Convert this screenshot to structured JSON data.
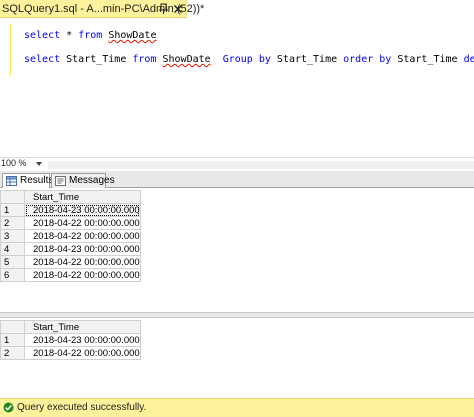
{
  "window": {
    "tab_title": "SQLQuery1.sql - A...min-PC\\Admin (52))*"
  },
  "editor": {
    "lines": [
      {
        "kw1": "select",
        "mid1": " * ",
        "kw2": "from",
        "mid2": " ",
        "obj": "ShowDate"
      },
      {
        "kw1": "select",
        "mid1": " Start_Time ",
        "kw2": "from",
        "mid2": " ",
        "obj": "ShowDate",
        "rest_space": "  ",
        "kw3": "Group by",
        "col1": " Start_Time ",
        "kw4": "order by",
        "col2": " Start_Time ",
        "kw5": "desc"
      }
    ]
  },
  "zoom": {
    "value": "100 %"
  },
  "results_tabs": {
    "results_label": "Results",
    "messages_label": "Messages"
  },
  "grid1": {
    "column": "Start_Time",
    "rows": [
      {
        "num": "1",
        "value": "2018-04-23 00:00:00.000"
      },
      {
        "num": "2",
        "value": "2018-04-22 00:00:00.000"
      },
      {
        "num": "3",
        "value": "2018-04-22 00:00:00.000"
      },
      {
        "num": "4",
        "value": "2018-04-23 00:00:00.000"
      },
      {
        "num": "5",
        "value": "2018-04-22 00:00:00.000"
      },
      {
        "num": "6",
        "value": "2018-04-22 00:00:00.000"
      }
    ]
  },
  "grid2": {
    "column": "Start_Time",
    "rows": [
      {
        "num": "1",
        "value": "2018-04-23 00:00:00.000"
      },
      {
        "num": "2",
        "value": "2018-04-22 00:00:00.000"
      }
    ]
  },
  "status": {
    "message": "Query executed successfully."
  },
  "colors": {
    "tab_yellow": "#fff29d",
    "keyword_blue": "#0000ff",
    "squiggle_red": "#e51400",
    "status_ok_green": "#1e8a1e"
  },
  "icons": {
    "tab_pin": "pin-icon",
    "tab_close": "close-icon",
    "results_tab": "grid-icon",
    "messages_tab": "message-icon",
    "zoom_dropdown": "chevron-down-icon",
    "status": "check-circle-icon"
  }
}
